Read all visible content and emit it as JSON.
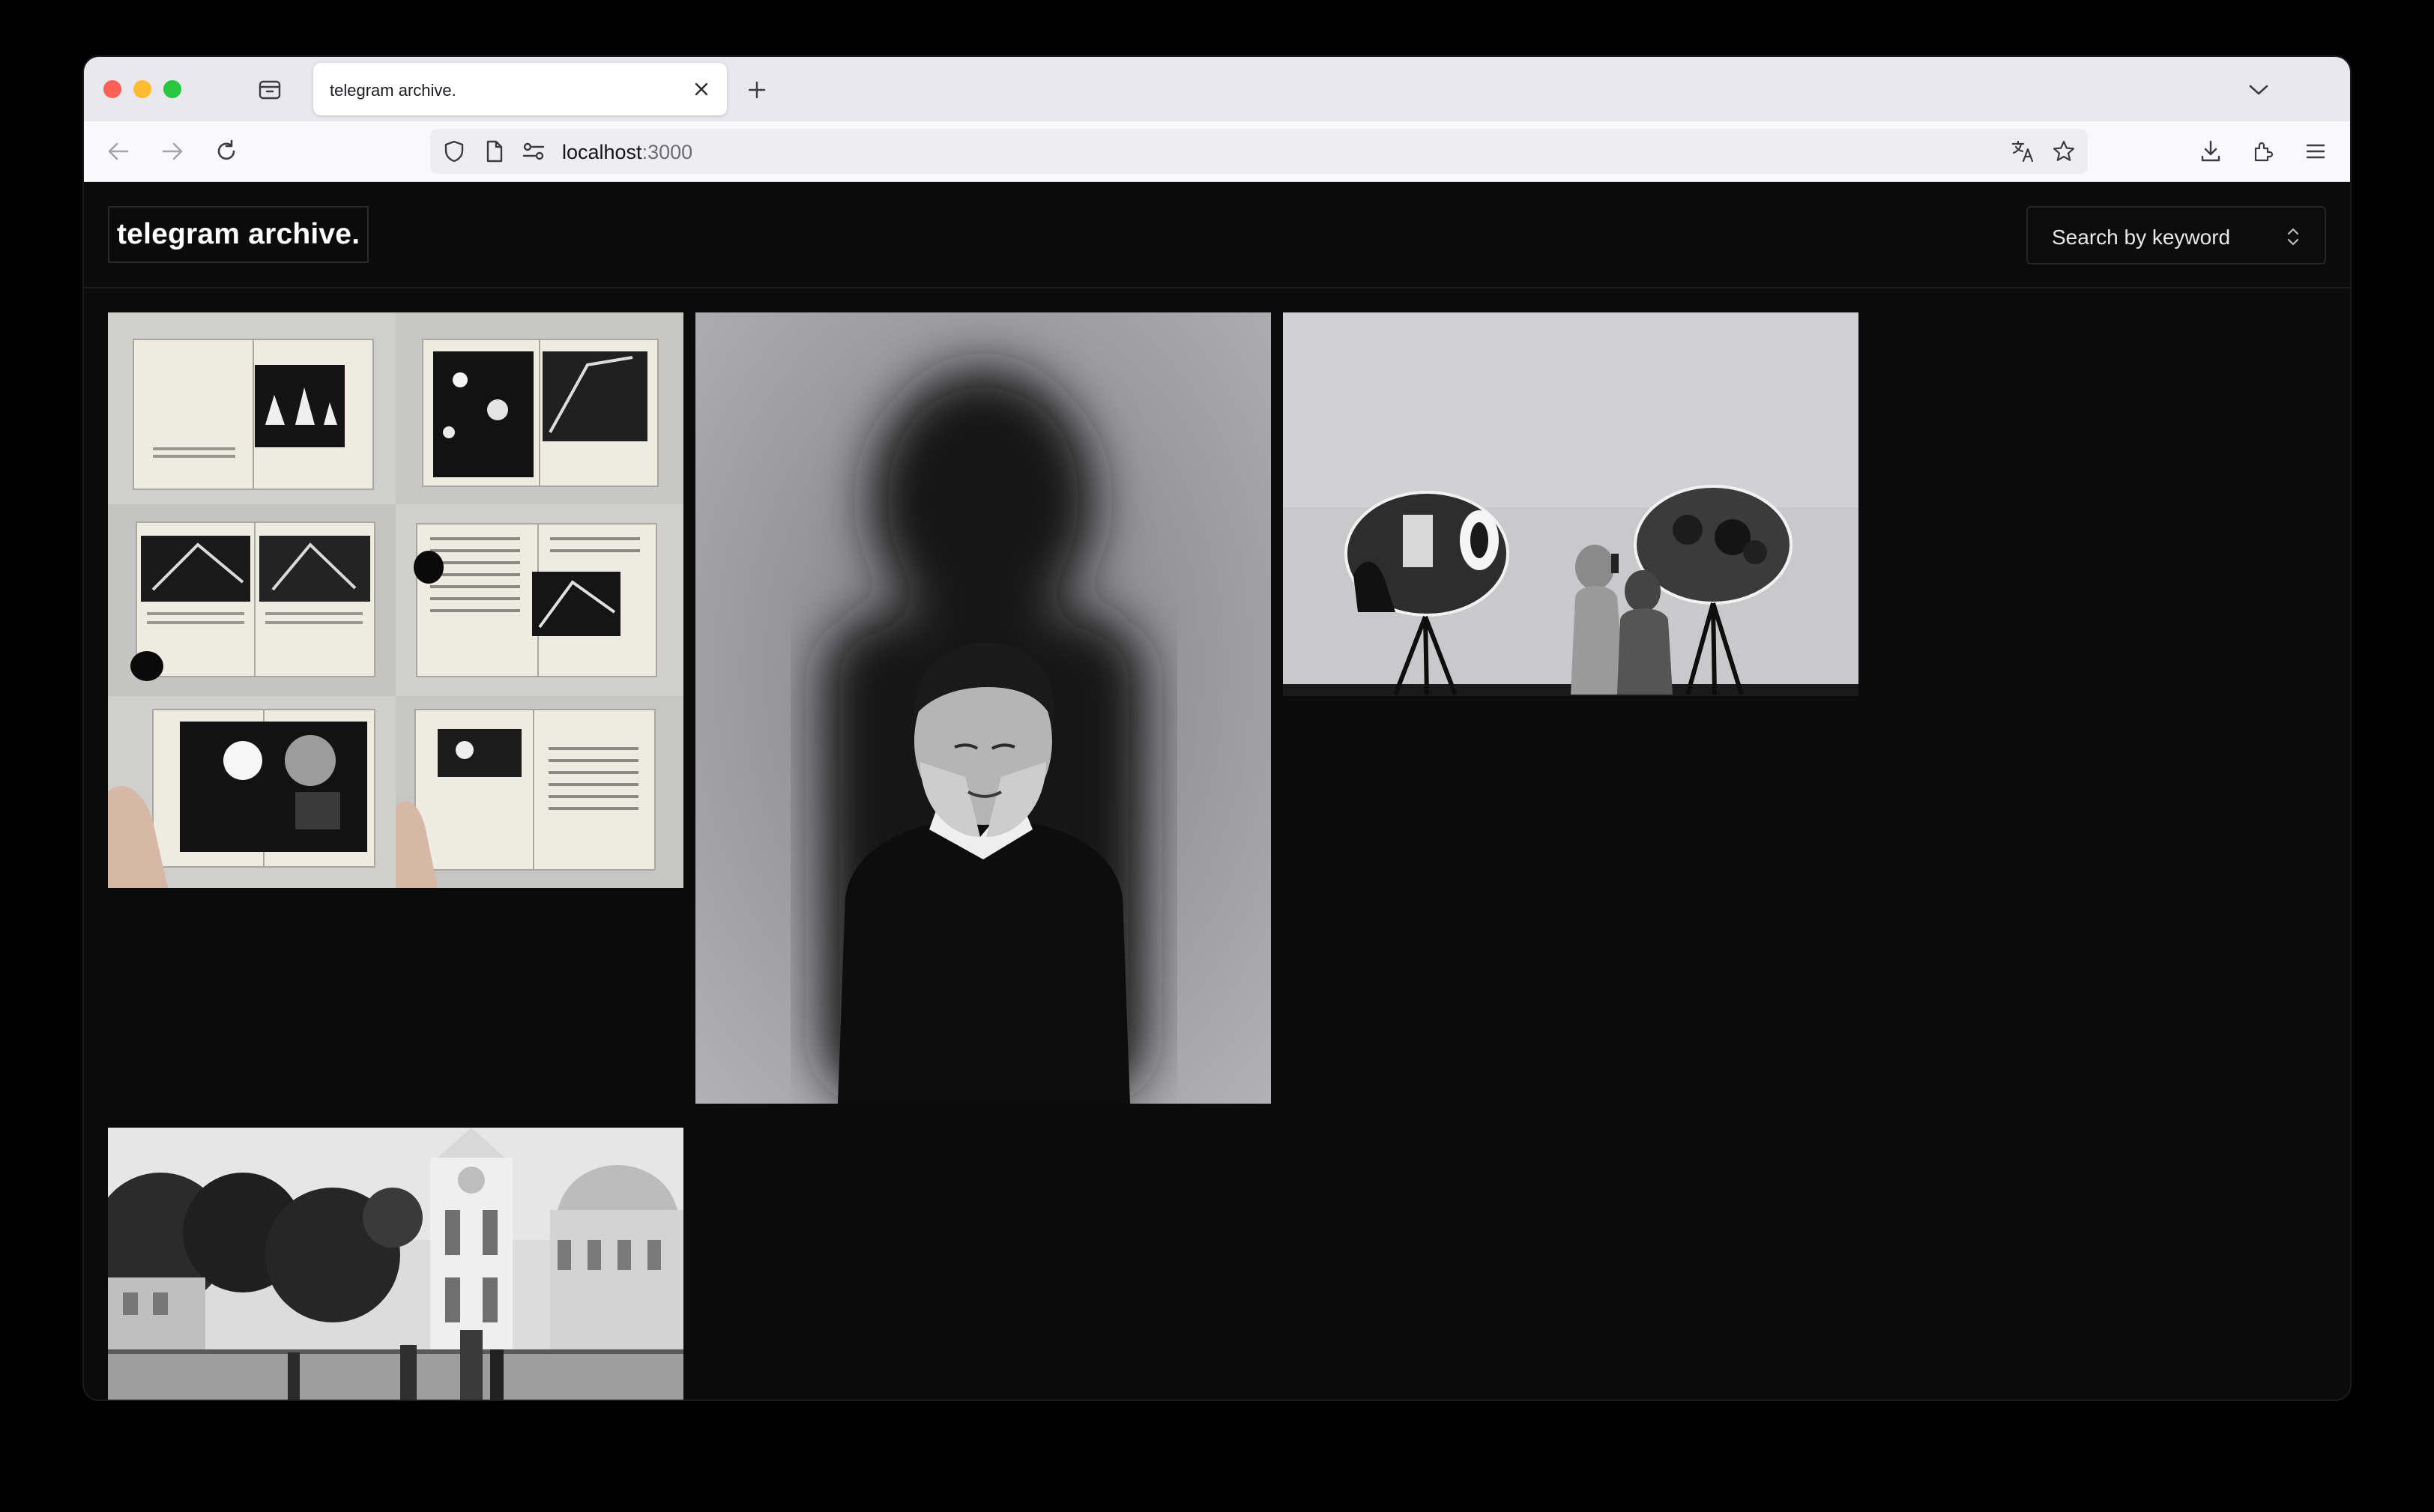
{
  "browser": {
    "tab_title": "telegram archive.",
    "url_host": "localhost",
    "url_port": ":3000",
    "icons": {
      "tabs": "tab-overview-icon",
      "close_tab": "close-icon",
      "new_tab": "plus-icon",
      "tab_list": "chevron-down-icon",
      "back": "back-arrow-icon",
      "forward": "forward-arrow-icon",
      "reload": "reload-icon",
      "shield": "shield-icon",
      "page": "page-icon",
      "permissions": "permissions-icon",
      "translate": "translate-icon",
      "bookmark": "star-icon",
      "downloads": "download-icon",
      "extensions": "extensions-icon",
      "menu": "hamburger-menu-icon"
    }
  },
  "site": {
    "logo": "telegram archive.",
    "search": {
      "label": "Search by keyword",
      "icon": "updown-chevron-icon"
    }
  },
  "gallery": {
    "items": [
      {
        "name": "photo-book-spreads",
        "kind": "grid of six open photo book spreads"
      },
      {
        "name": "photo-shadow-portrait",
        "kind": "portrait of person with hands on face in front of large shadow"
      },
      {
        "name": "photo-mirror-exhibit",
        "kind": "visitors beside oval mirrors on tripod stands"
      },
      {
        "name": "photo-mosque-street",
        "kind": "street scene with mosque and clock tower"
      }
    ]
  },
  "colors": {
    "page_bg": "#0b0b0b",
    "chrome_tabstrip": "#e9e8ee",
    "chrome_navbar": "#f9f9fb",
    "logo_text": "#ffffff"
  }
}
